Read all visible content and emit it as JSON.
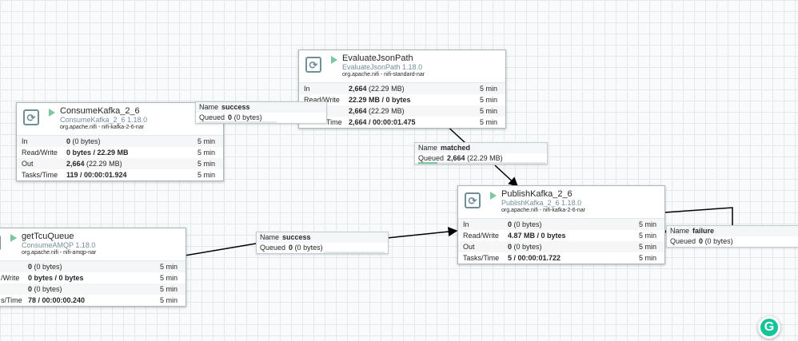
{
  "canvas": {
    "processors": [
      {
        "name": "ConsumeKafka_2_6",
        "type": "ConsumeKafka_2_6 1.18.0",
        "bundle": "org.apache.nifi - nifi-kafka-2-6-nar",
        "stats": [
          {
            "key": "In",
            "value": "0",
            "sub": "(0 bytes)",
            "time": "5 min"
          },
          {
            "key": "Read/Write",
            "value": "0 bytes / 22.29 MB",
            "sub": "",
            "time": "5 min"
          },
          {
            "key": "Out",
            "value": "2,664",
            "sub": "(22.29 MB)",
            "time": "5 min"
          },
          {
            "key": "Tasks/Time",
            "value": "119 / 00:00:01.924",
            "sub": "",
            "time": "5 min"
          }
        ]
      },
      {
        "name": "EvaluateJsonPath",
        "type": "EvaluateJsonPath 1.18.0",
        "bundle": "org.apache.nifi - nifi-standard-nar",
        "stats": [
          {
            "key": "In",
            "value": "2,664",
            "sub": "(22.29 MB)",
            "time": "5 min"
          },
          {
            "key": "Read/Write",
            "value": "22.29 MB / 0 bytes",
            "sub": "",
            "time": "5 min"
          },
          {
            "key": "",
            "value": "2,664",
            "sub": "(22.29 MB)",
            "time": "5 min"
          },
          {
            "key": "Time",
            "value": "2,664 / 00:00:01.475",
            "sub": "",
            "time": "5 min"
          }
        ]
      },
      {
        "name": "PublishKafka_2_6",
        "type": "PublishKafka_2_6 1.18.0",
        "bundle": "org.apache.nifi - nifi-kafka-2-6-nar",
        "stats": [
          {
            "key": "In",
            "value": "0",
            "sub": "(0 bytes)",
            "time": "5 min"
          },
          {
            "key": "Read/Write",
            "value": "4.87 MB / 0 bytes",
            "sub": "",
            "time": "5 min"
          },
          {
            "key": "Out",
            "value": "0",
            "sub": "(0 bytes)",
            "time": "5 min"
          },
          {
            "key": "Tasks/Time",
            "value": "5 / 00:00:01.722",
            "sub": "",
            "time": "5 min"
          }
        ]
      },
      {
        "name": "getTcuQueue",
        "type": "ConsumeAMQP 1.18.0",
        "bundle": "org.apache.nifi - nifi-amqp-nar",
        "stats": [
          {
            "key": "",
            "value": "0",
            "sub": "(0 bytes)",
            "time": "5 min"
          },
          {
            "key": "/Write",
            "value": "0 bytes / 0 bytes",
            "sub": "",
            "time": "5 min"
          },
          {
            "key": "",
            "value": "0",
            "sub": "(0 bytes)",
            "time": "5 min"
          },
          {
            "key": "s/Time",
            "value": "78 / 00:00:00.240",
            "sub": "",
            "time": "5 min"
          }
        ]
      }
    ],
    "connections": [
      {
        "name_label": "Name",
        "name": "success",
        "queued_label": "Queued",
        "queued": "0",
        "queued_sub": "(0 bytes)",
        "fill_fraction": 0.0
      },
      {
        "name_label": "Name",
        "name": "matched",
        "queued_label": "Queued",
        "queued": "2,664",
        "queued_sub": "(22.29 MB)",
        "fill_fraction": 0.15
      },
      {
        "name_label": "Name",
        "name": "success",
        "queued_label": "Queued",
        "queued": "0",
        "queued_sub": "(0 bytes)",
        "fill_fraction": 0.0
      },
      {
        "name_label": "Name",
        "name": "failure",
        "queued_label": "Queued",
        "queued": "0",
        "queued_sub": "(0 bytes)",
        "fill_fraction": 0.0
      }
    ],
    "colors": {
      "running": "#7dc7a0",
      "icon_border": "#728e9b",
      "queue_fill": "#7dc7a0",
      "grammarly": "#15c39a"
    },
    "grammarly_button": "G"
  }
}
